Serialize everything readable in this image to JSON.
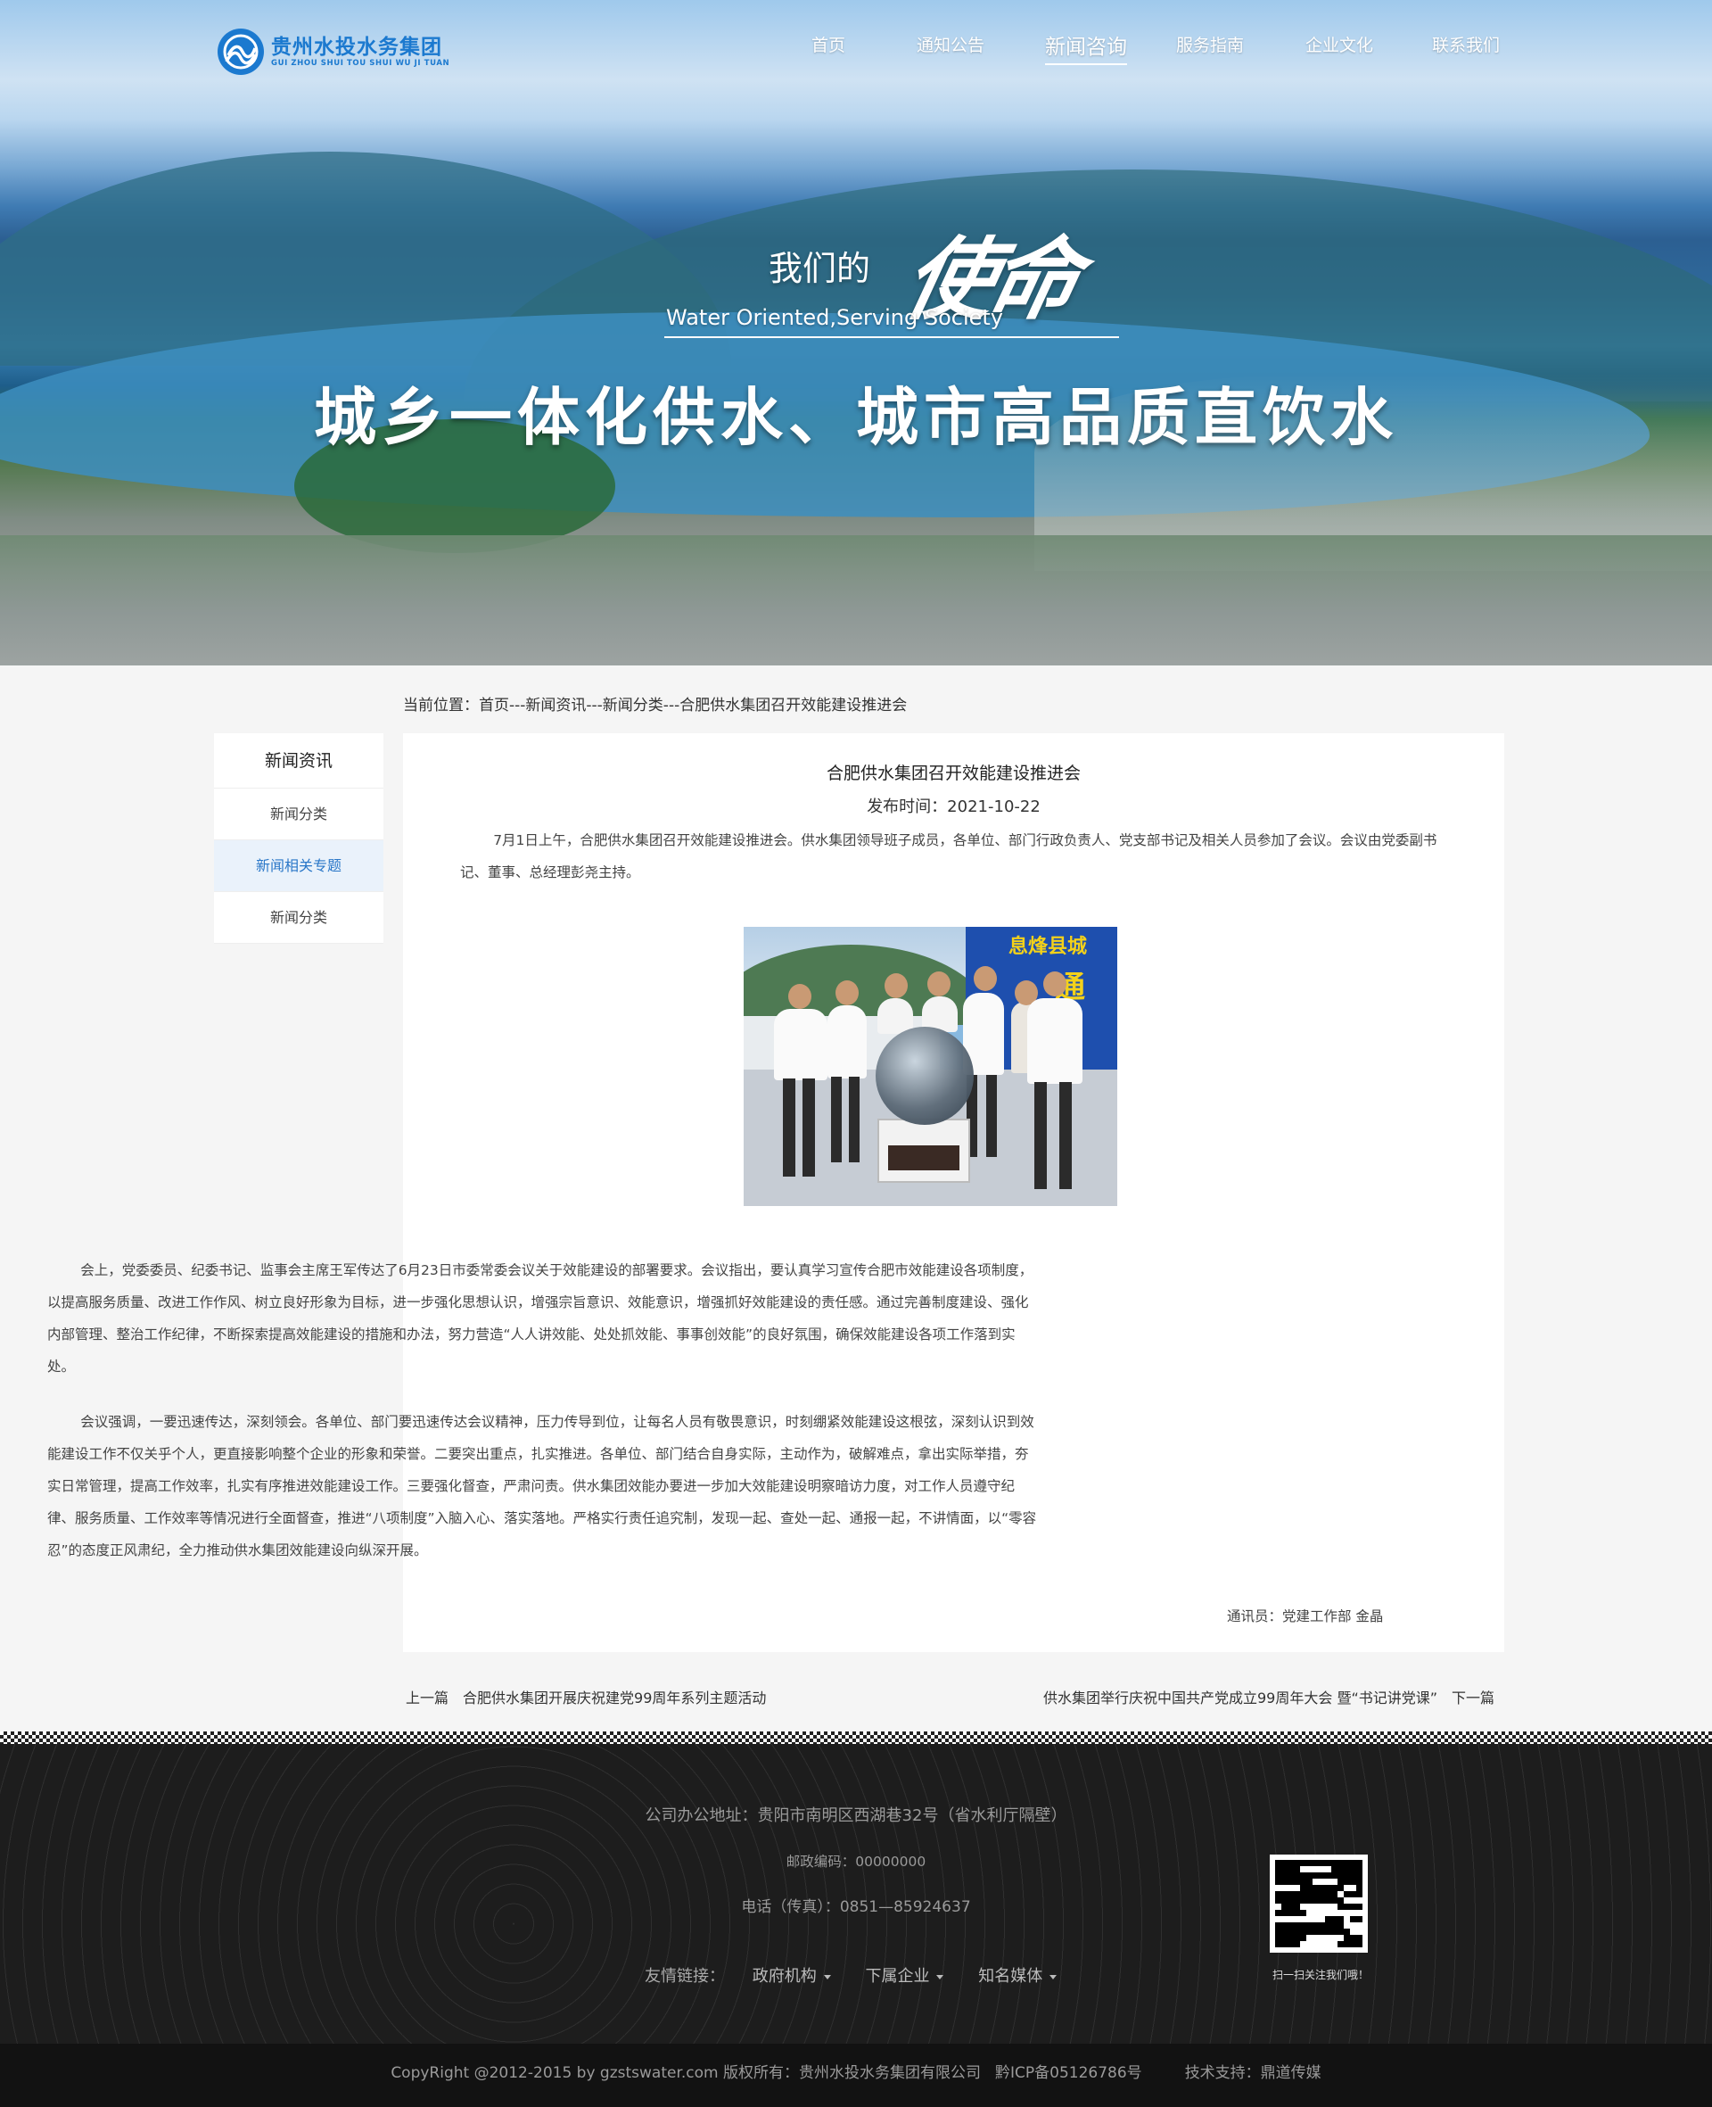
{
  "logo": {
    "cn": "贵州水投水务集团",
    "en": "GUI ZHOU SHUI TOU SHUI WU JI TUAN"
  },
  "nav": [
    "首页",
    "通知公告",
    "新闻咨询",
    "服务指南",
    "企业文化",
    "联系我们"
  ],
  "nav_active": "新闻咨询",
  "hero": {
    "we": "我们的",
    "mission": "使命",
    "en": "Water Oriented,Serving Society",
    "main": "城乡一体化供水、城市高品质直饮水"
  },
  "breadcrumb": "当前位置：首页---新闻资讯---新闻分类---合肥供水集团召开效能建设推进会",
  "sidebar": {
    "title": "新闻资讯",
    "items": [
      "新闻分类",
      "新闻相关专题",
      "新闻分类"
    ],
    "active_index": 1
  },
  "article": {
    "title": "合肥供水集团召开效能建设推进会",
    "date": "发布时间：2021-10-22",
    "p1": "7月1日上午，合肥供水集团召开效能建设推进会。供水集团领导班子成员，各单位、部门行政负责人、党支部书记及相关人员参加了会议。会议由党委副书记、董事、总经理彭尧主持。",
    "photo_banner_1": "息烽县城",
    "photo_banner_2": "通",
    "p2": "会上，党委委员、纪委书记、监事会主席王军传达了6月23日市委常委会议关于效能建设的部署要求。会议指出，要认真学习宣传合肥市效能建设各项制度，以提高服务质量、改进工作作风、树立良好形象为目标，进一步强化思想认识，增强宗旨意识、效能意识，增强抓好效能建设的责任感。通过完善制度建设、强化内部管理、整治工作纪律，不断探索提高效能建设的措施和办法，努力营造“人人讲效能、处处抓效能、事事创效能”的良好氛围，确保效能建设各项工作落到实处。",
    "p3": "会议强调，一要迅速传达，深刻领会。各单位、部门要迅速传达会议精神，压力传导到位，让每名人员有敬畏意识，时刻绷紧效能建设这根弦，深刻认识到效能建设工作不仅关乎个人，更直接影响整个企业的形象和荣誉。二要突出重点，扎实推进。各单位、部门结合自身实际，主动作为，破解难点，拿出实际举措，夯实日常管理，提高工作效率，扎实有序推进效能建设工作。三要强化督查，严肃问责。供水集团效能办要进一步加大效能建设明察暗访力度，对工作人员遵守纪律、服务质量、工作效率等情况进行全面督查，推进“八项制度”入脑入心、落实落地。严格实行责任追究制，发现一起、查处一起、通报一起，不讲情面，以“零容忍”的态度正风肃纪，全力推动供水集团效能建设向纵深开展。",
    "byline": "通讯员：党建工作部 金晶"
  },
  "pager": {
    "prev_label": "上一篇",
    "prev_title": "合肥供水集团开展庆祝建党99周年系列主题活动",
    "next_title": "供水集团举行庆祝中国共产党成立99周年大会 暨“书记讲党课”",
    "next_label": "下一篇"
  },
  "footer": {
    "address": "公司办公地址：贵阳市南明区西湖巷32号（省水利厅隔壁）",
    "zip": "邮政编码：00000000",
    "tel": "电话（传真）：0851—85924637",
    "links_label": "友情链接：",
    "links": [
      "政府机构",
      "下属企业",
      "知名媒体"
    ],
    "qr_tip": "扫一扫关注我们哦！",
    "copyright": "CopyRight @2012-2015 by gzstswater.com 版权所有：贵州水投水务集团有限公司",
    "icp": "黔ICP备05126786号",
    "support": "技术支持：鼎道传媒"
  }
}
